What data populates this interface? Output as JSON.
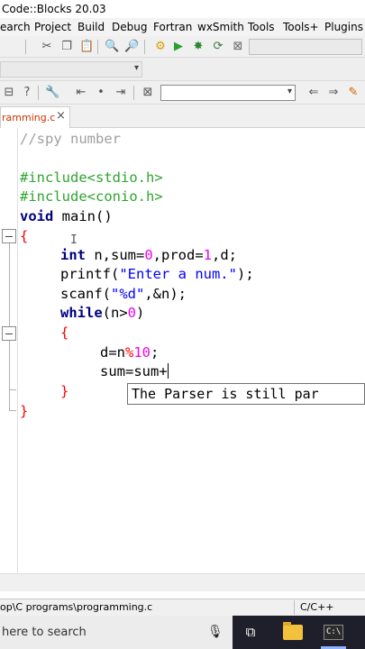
{
  "window": {
    "title": "Code::Blocks 20.03"
  },
  "menu": {
    "items": [
      "earch",
      "Project",
      "Build",
      "Debug",
      "Fortran",
      "wxSmith",
      "Tools",
      "Tools+",
      "Plugins"
    ]
  },
  "toolbar": {
    "icons": {
      "cut": "scissors-icon",
      "copy": "copy-icon",
      "paste": "paste-icon",
      "find": "find-icon",
      "replace": "replace-icon",
      "settings": "gear-icon",
      "run": "play-icon",
      "build_run": "build-run-icon",
      "rebuild": "rebuild-icon",
      "abort": "stop-icon"
    }
  },
  "editor_tab": {
    "name": "ramming.c",
    "close": "×"
  },
  "code_lines": [
    "//spy number",
    "",
    "#include<stdio.h>",
    "#include<conio.h>",
    "void main()",
    "{",
    "int n,sum=0,prod=1,d;",
    "printf(\"Enter a num.\");",
    "scanf(\"%d\",&n);",
    "while(n>0)",
    "{",
    "d=n%10;",
    "sum=sum+",
    "}",
    "}"
  ],
  "tooltip": {
    "text": "The Parser is still par"
  },
  "status": {
    "path": "op\\C programs\\programming.c",
    "language": "C/C++"
  },
  "taskbar": {
    "search_placeholder": "here to search",
    "icons": [
      "microphone-icon",
      "task-view-icon",
      "file-explorer-icon",
      "terminal-icon"
    ]
  },
  "colors": {
    "comment": "#a0a0a0",
    "preprocessor": "#2ea52e",
    "keyword": "#000080",
    "number": "#f000f0",
    "string": "#0000ff",
    "operator": "#ff0000",
    "tab_text": "#cc3300",
    "taskbar": "#1f1f2b"
  }
}
